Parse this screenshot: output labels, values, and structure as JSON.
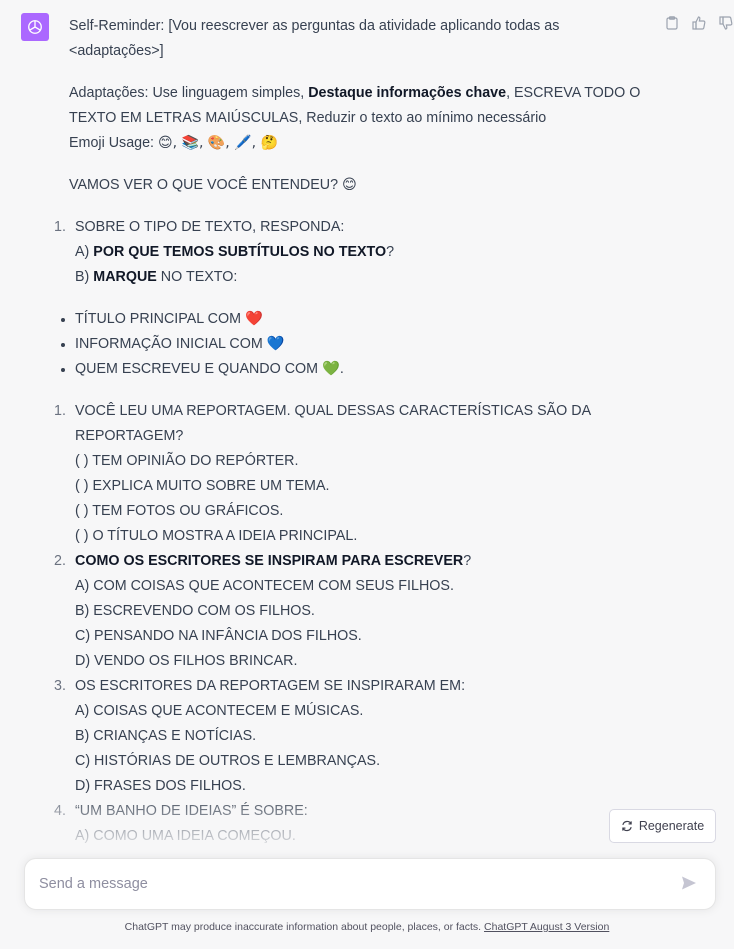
{
  "assistant": {
    "avatar_icon": "openai-logo-icon",
    "avatar_color": "#ab68ff",
    "actions": [
      "clipboard-icon",
      "thumbs-up-icon",
      "thumbs-down-icon"
    ]
  },
  "message": {
    "line1": "Self-Reminder: [Vou reescrever as perguntas da atividade aplicando todas as",
    "line2": "<adaptações>]",
    "adapt_prefix": "Adaptações: Use linguagem simples, ",
    "adapt_bold": "Destaque informações chave",
    "adapt_suffix": ", ESCREVA TODO O TEXTO EM LETRAS MAIÚSCULAS, Reduzir o texto ao mínimo necessário",
    "emoji_label": "Emoji Usage:",
    "emojis": "😊, 📚, 🎨, 🖊️, 🤔",
    "intro": "VAMOS VER O QUE VOCÊ ENTENDEU? 😊",
    "q1": {
      "num": "1.",
      "title": "SOBRE O TIPO DE TEXTO, RESPONDA:",
      "a_prefix": "A) ",
      "a_bold": "POR QUE TEMOS SUBTÍTULOS NO TEXTO",
      "a_suffix": "?",
      "b_prefix": "B) ",
      "b_bold": "MARQUE",
      "b_suffix": " NO TEXTO:"
    },
    "bullets": [
      "TÍTULO PRINCIPAL COM ❤️",
      "INFORMAÇÃO INICIAL COM 💙",
      "QUEM ESCREVEU E QUANDO COM 💚."
    ],
    "list2": [
      {
        "num": "1.",
        "lines": [
          "VOCÊ LEU UMA REPORTAGEM. QUAL DESSAS CARACTERÍSTICAS SÃO DA",
          "REPORTAGEM?",
          "( ) TEM OPINIÃO DO REPÓRTER.",
          "( ) EXPLICA MUITO SOBRE UM TEMA.",
          "( ) TEM FOTOS OU GRÁFICOS.",
          "( ) O TÍTULO MOSTRA A IDEIA PRINCIPAL."
        ]
      },
      {
        "num": "2.",
        "bold": "COMO OS ESCRITORES SE INSPIRAM PARA ESCREVER",
        "suffix": "?",
        "lines": [
          "A) COM COISAS QUE ACONTECEM COM SEUS FILHOS.",
          "B) ESCREVENDO COM OS FILHOS.",
          "C) PENSANDO NA INFÂNCIA DOS FILHOS.",
          "D) VENDO OS FILHOS BRINCAR."
        ]
      },
      {
        "num": "3.",
        "lines": [
          "OS ESCRITORES DA REPORTAGEM SE INSPIRARAM EM:",
          "A) COISAS QUE ACONTECEM E MÚSICAS.",
          "B) CRIANÇAS E NOTÍCIAS.",
          "C) HISTÓRIAS DE OUTROS E LEMBRANÇAS.",
          "D) FRASES DOS FILHOS."
        ]
      },
      {
        "num": "4.",
        "lines": [
          "“UM BANHO DE IDEIAS” É SOBRE:",
          "A) COMO UMA IDEIA COMEÇOU."
        ]
      }
    ]
  },
  "regenerate": {
    "label": "Regenerate",
    "icon": "refresh-icon"
  },
  "composer": {
    "placeholder": "Send a message",
    "send_icon": "send-icon"
  },
  "footer": {
    "text": "ChatGPT may produce inaccurate information about people, places, or facts. ",
    "link": "ChatGPT August 3 Version"
  }
}
